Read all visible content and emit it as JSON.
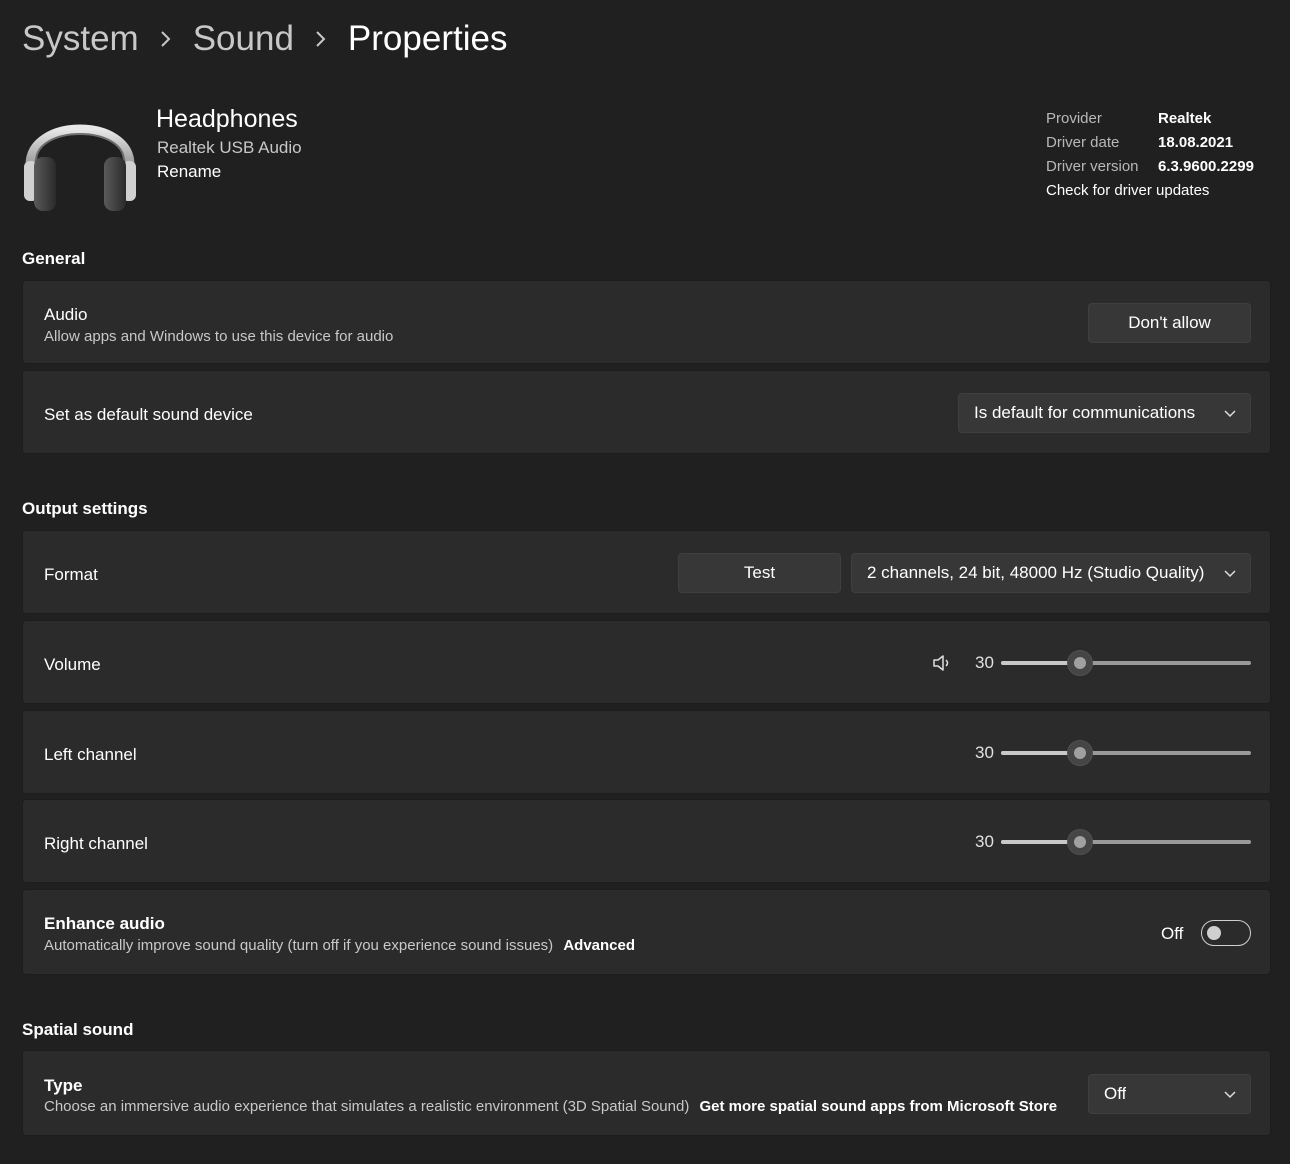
{
  "breadcrumb": {
    "items": [
      "System",
      "Sound",
      "Properties"
    ]
  },
  "device": {
    "name": "Headphones",
    "subtitle": "Realtek USB Audio",
    "rename_label": "Rename",
    "icon": "headphones-icon"
  },
  "driver_info": {
    "provider_label": "Provider",
    "provider_value": "Realtek",
    "date_label": "Driver date",
    "date_value": "18.08.2021",
    "version_label": "Driver version",
    "version_value": "6.3.9600.2299",
    "update_link": "Check for driver updates"
  },
  "general": {
    "header": "General",
    "audio": {
      "title": "Audio",
      "description": "Allow apps and Windows to use this device for audio",
      "button_label": "Don't allow"
    },
    "default_device": {
      "title": "Set as default sound device",
      "selected": "Is default for communications"
    }
  },
  "output": {
    "header": "Output settings",
    "format": {
      "title": "Format",
      "test_label": "Test",
      "selected": "2 channels, 24 bit, 48000 Hz (Studio Quality)"
    },
    "volume": {
      "title": "Volume",
      "value": "30",
      "level": 30,
      "icon": "speaker-icon"
    },
    "left": {
      "title": "Left channel",
      "value": "30",
      "level": 30
    },
    "right": {
      "title": "Right channel",
      "value": "30",
      "level": 30
    },
    "enhance": {
      "title": "Enhance audio",
      "description": "Automatically improve sound quality (turn off if you experience sound issues)",
      "advanced_label": "Advanced",
      "state_label": "Off",
      "on": false
    }
  },
  "spatial": {
    "header": "Spatial sound",
    "type": {
      "title": "Type",
      "description": "Choose an immersive audio experience that simulates a realistic environment (3D Spatial Sound)",
      "store_link": "Get more spatial sound apps from Microsoft Store",
      "selected": "Off"
    }
  },
  "colors": {
    "background": "#202020",
    "card": "#2b2b2b",
    "button": "#373737"
  }
}
